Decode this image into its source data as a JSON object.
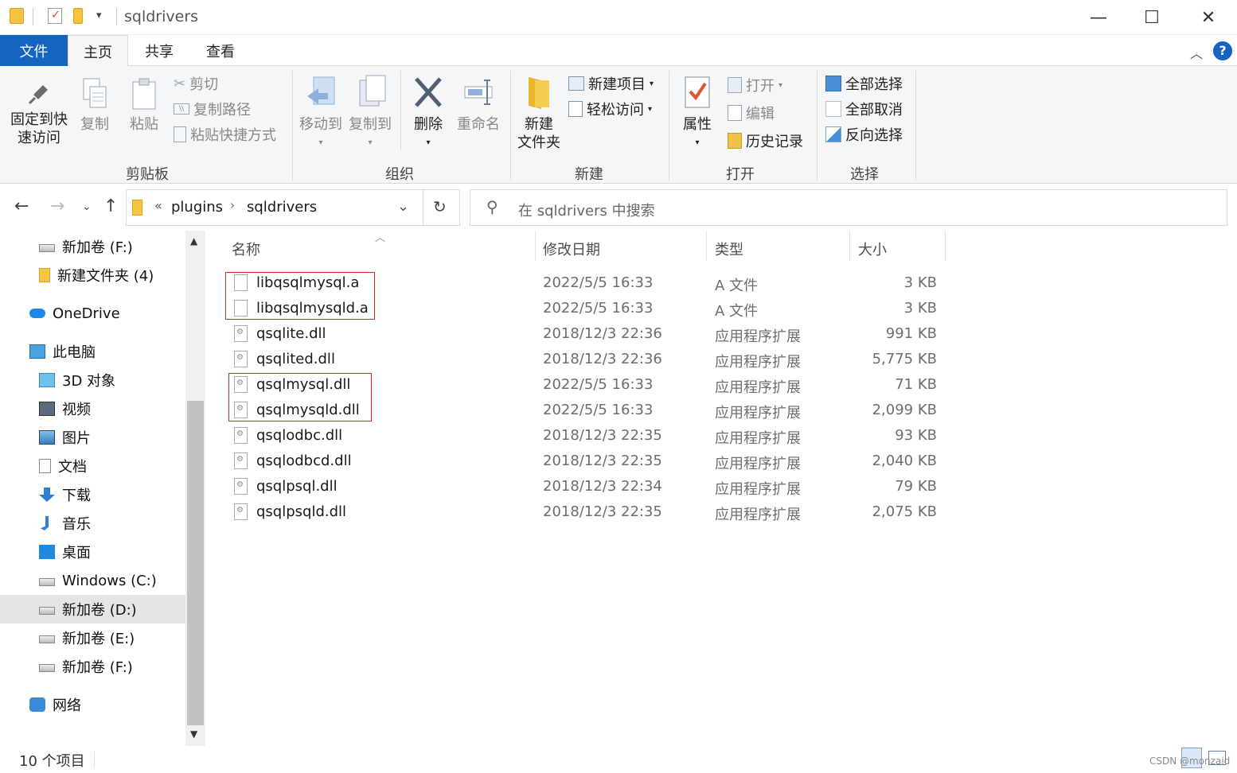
{
  "window": {
    "title": "sqldrivers",
    "controls": {
      "minimize": "—",
      "maximize": "☐",
      "close": "✕"
    }
  },
  "ribbon_tabs": [
    "文件",
    "主页",
    "共享",
    "查看"
  ],
  "ribbon": {
    "clipboard": {
      "pin": "固定到快\n速访问",
      "copy": "复制",
      "paste": "粘贴",
      "cut": "剪切",
      "copy_path": "复制路径",
      "paste_shortcut": "粘贴快捷方式",
      "label": "剪贴板"
    },
    "organize": {
      "move_to": "移动到",
      "copy_to": "复制到",
      "delete": "删除",
      "rename": "重命名",
      "label": "组织"
    },
    "new": {
      "new_folder": "新建\n文件夹",
      "new_item": "新建项目",
      "easy_access": "轻松访问",
      "label": "新建"
    },
    "open": {
      "properties": "属性",
      "open": "打开",
      "edit": "编辑",
      "history": "历史记录",
      "label": "打开"
    },
    "select": {
      "select_all": "全部选择",
      "select_none": "全部取消",
      "invert": "反向选择",
      "label": "选择"
    }
  },
  "address": {
    "breadcrumb_prefix": "«",
    "crumbs": [
      "plugins",
      "sqldrivers"
    ],
    "search_placeholder": "在 sqldrivers 中搜索"
  },
  "nav_pane": [
    {
      "label": "新加卷 (F:)",
      "icon": "drive-icon",
      "indent": 1
    },
    {
      "label": "新建文件夹 (4)",
      "icon": "folder-icon",
      "indent": 1
    },
    {
      "label": "OneDrive",
      "icon": "onedrive-icon",
      "indent": 0
    },
    {
      "label": "此电脑",
      "icon": "computer-icon",
      "indent": 0
    },
    {
      "label": "3D 对象",
      "icon": "3d-objects-icon",
      "indent": 1
    },
    {
      "label": "视频",
      "icon": "video-icon",
      "indent": 1
    },
    {
      "label": "图片",
      "icon": "pictures-icon",
      "indent": 1
    },
    {
      "label": "文档",
      "icon": "documents-icon",
      "indent": 1
    },
    {
      "label": "下载",
      "icon": "download-icon",
      "indent": 1
    },
    {
      "label": "音乐",
      "icon": "music-icon",
      "indent": 1
    },
    {
      "label": "桌面",
      "icon": "desktop-icon",
      "indent": 1
    },
    {
      "label": "Windows (C:)",
      "icon": "windows-drive-icon",
      "indent": 1
    },
    {
      "label": "新加卷 (D:)",
      "icon": "drive-icon",
      "indent": 1,
      "selected": true
    },
    {
      "label": "新加卷 (E:)",
      "icon": "drive-icon",
      "indent": 1
    },
    {
      "label": "新加卷 (F:)",
      "icon": "drive-icon",
      "indent": 1
    },
    {
      "label": "网络",
      "icon": "network-icon",
      "indent": 0
    }
  ],
  "columns": [
    "名称",
    "修改日期",
    "类型",
    "大小"
  ],
  "files": [
    {
      "name": "libqsqlmysql.a",
      "date": "2022/5/5 16:33",
      "type": "A 文件",
      "size": "3 KB",
      "kind": "file"
    },
    {
      "name": "libqsqlmysqld.a",
      "date": "2022/5/5 16:33",
      "type": "A 文件",
      "size": "3 KB",
      "kind": "file"
    },
    {
      "name": "qsqlite.dll",
      "date": "2018/12/3 22:36",
      "type": "应用程序扩展",
      "size": "991 KB",
      "kind": "dll"
    },
    {
      "name": "qsqlited.dll",
      "date": "2018/12/3 22:36",
      "type": "应用程序扩展",
      "size": "5,775 KB",
      "kind": "dll"
    },
    {
      "name": "qsqlmysql.dll",
      "date": "2022/5/5 16:33",
      "type": "应用程序扩展",
      "size": "71 KB",
      "kind": "dll"
    },
    {
      "name": "qsqlmysqld.dll",
      "date": "2022/5/5 16:33",
      "type": "应用程序扩展",
      "size": "2,099 KB",
      "kind": "dll"
    },
    {
      "name": "qsqlodbc.dll",
      "date": "2018/12/3 22:35",
      "type": "应用程序扩展",
      "size": "93 KB",
      "kind": "dll"
    },
    {
      "name": "qsqlodbcd.dll",
      "date": "2018/12/3 22:35",
      "type": "应用程序扩展",
      "size": "2,040 KB",
      "kind": "dll"
    },
    {
      "name": "qsqlpsql.dll",
      "date": "2018/12/3 22:34",
      "type": "应用程序扩展",
      "size": "79 KB",
      "kind": "dll"
    },
    {
      "name": "qsqlpsqld.dll",
      "date": "2018/12/3 22:35",
      "type": "应用程序扩展",
      "size": "2,075 KB",
      "kind": "dll"
    }
  ],
  "status": {
    "count": "10 个项目",
    "watermark": "CSDN @monzaid"
  },
  "colors": {
    "accent": "#1565c0",
    "highlight_box": "#e0262b",
    "folder": "#f5c542"
  }
}
